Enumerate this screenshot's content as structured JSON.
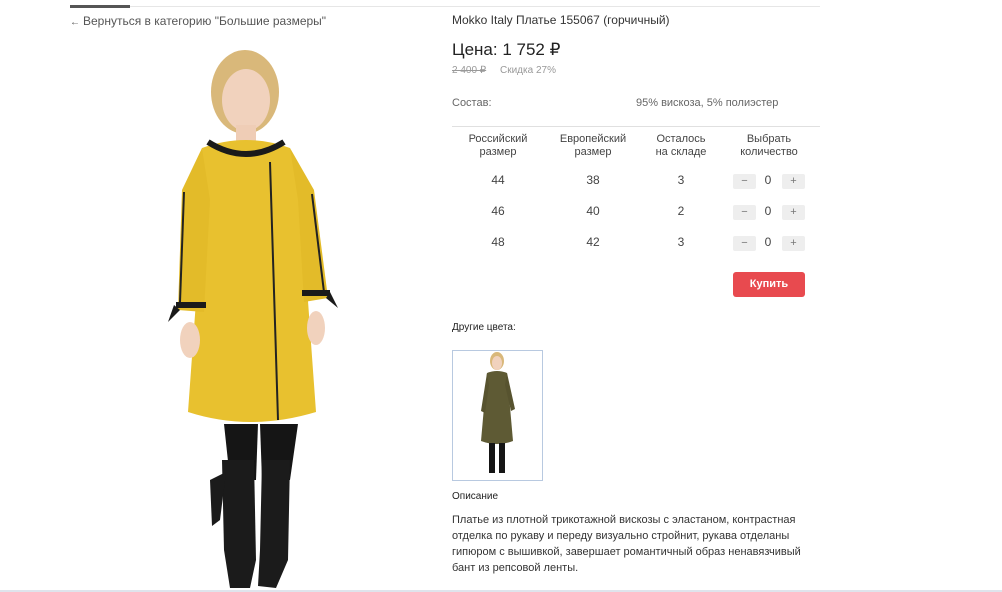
{
  "nav": {
    "back_label": "Вернуться в категорию \"Большие размеры\"",
    "back_icon": "arrow-left-icon"
  },
  "product": {
    "title": "Mokko Italy Платье 155067 (горчичный)",
    "price": "Цена: 1 752 ₽",
    "old_price": "2 400 ₽",
    "discount": "Скидка 27%",
    "composition_label": "Состав:",
    "composition_value": "95% вискоза, 5% полиэстер",
    "dress_color": "#e8c12f"
  },
  "table": {
    "headers": {
      "ru_size": [
        "Российский",
        "размер"
      ],
      "eu_size": [
        "Европейский",
        "размер"
      ],
      "stock": [
        "Осталось",
        "на складе"
      ],
      "qty": [
        "Выбрать",
        "количество"
      ]
    },
    "rows": [
      {
        "ru": "44",
        "eu": "38",
        "stock": "3",
        "qty": "0"
      },
      {
        "ru": "46",
        "eu": "40",
        "stock": "2",
        "qty": "0"
      },
      {
        "ru": "48",
        "eu": "42",
        "stock": "3",
        "qty": "0"
      }
    ],
    "minus": "−",
    "plus": "+"
  },
  "buy_label": "Купить",
  "buy_color": "#e84a4f",
  "other_colors_label": "Другие цвета:",
  "description_label": "Описание",
  "description": "Платье из плотной трикотажной вискозы с эластаном, контрастная отделка по рукаву и переду визуально стройнит, рукава отделаны гипюром с вышивкой, завершает романтичный образ ненавязчивый бант из репсовой ленты."
}
